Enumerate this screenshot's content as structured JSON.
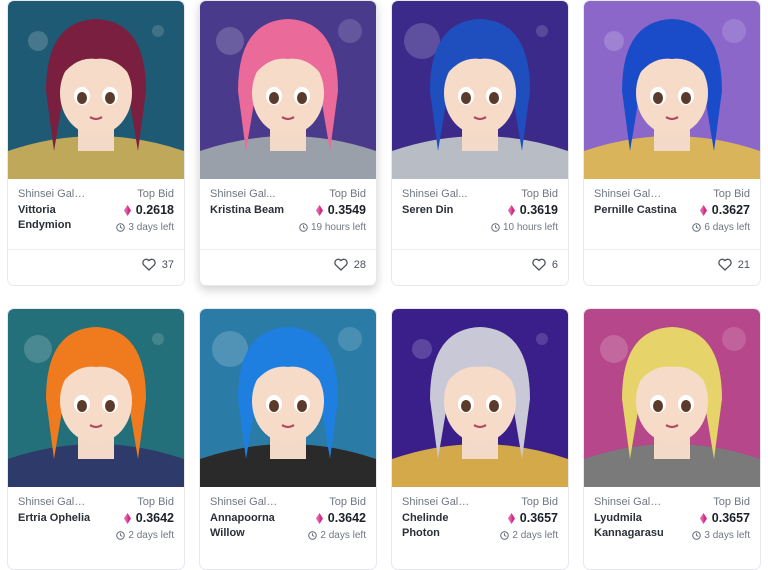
{
  "cards": [
    {
      "collection": "Shinsei Galv...",
      "name": "Vittoria Endymion",
      "top_bid_label": "Top Bid",
      "price": "0.2618",
      "time_left": "3 days left",
      "likes": "37",
      "hair": "#7a1f3f",
      "bg": "#1e5a73",
      "accent": "#c0a85a"
    },
    {
      "collection": "Shinsei Gal...",
      "name": "Kristina Beam",
      "top_bid_label": "Top Bid",
      "price": "0.3549",
      "time_left": "19 hours left",
      "likes": "28",
      "hair": "#ea6a9a",
      "bg": "#4a3a8c",
      "accent": "#9aa0aa"
    },
    {
      "collection": "Shinsei Gal...",
      "name": "Seren Din",
      "top_bid_label": "Top Bid",
      "price": "0.3619",
      "time_left": "10 hours left",
      "likes": "6",
      "hair": "#1f4fbf",
      "bg": "#3b2a8a",
      "accent": "#b8bcc4"
    },
    {
      "collection": "Shinsei Galv...",
      "name": "Pernille Castina",
      "top_bid_label": "Top Bid",
      "price": "0.3627",
      "time_left": "6 days left",
      "likes": "21",
      "hair": "#1a4cc9",
      "bg": "#8a67c9",
      "accent": "#d9b45a"
    },
    {
      "collection": "Shinsei Galv...",
      "name": "Ertria Ophelia",
      "top_bid_label": "Top Bid",
      "price": "0.3642",
      "time_left": "2 days left",
      "likes": "",
      "hair": "#f07a1e",
      "bg": "#23707a",
      "accent": "#2e3a6a"
    },
    {
      "collection": "Shinsei Galv...",
      "name": "Annapoorna Willow",
      "top_bid_label": "Top Bid",
      "price": "0.3642",
      "time_left": "2 days left",
      "likes": "",
      "hair": "#1f7fe0",
      "bg": "#2a7ca6",
      "accent": "#2a2a2a"
    },
    {
      "collection": "Shinsei Galv...",
      "name": "Chelinde Photon",
      "top_bid_label": "Top Bid",
      "price": "0.3657",
      "time_left": "2 days left",
      "likes": "",
      "hair": "#c8c8d6",
      "bg": "#3a1e8a",
      "accent": "#d4a94a"
    },
    {
      "collection": "Shinsei Galv...",
      "name": "Lyudmila Kannagarasu",
      "top_bid_label": "Top Bid",
      "price": "0.3657",
      "time_left": "3 days left",
      "likes": "",
      "hair": "#e6d46a",
      "bg": "#b5478a",
      "accent": "#7a7a7a"
    }
  ],
  "colors": {
    "eth": "#d62a8a",
    "text": "#2a2f38",
    "muted": "#6f7782"
  },
  "icons": {
    "currency": "eth-diamond-icon",
    "clock": "clock-icon",
    "like": "heart-icon"
  }
}
